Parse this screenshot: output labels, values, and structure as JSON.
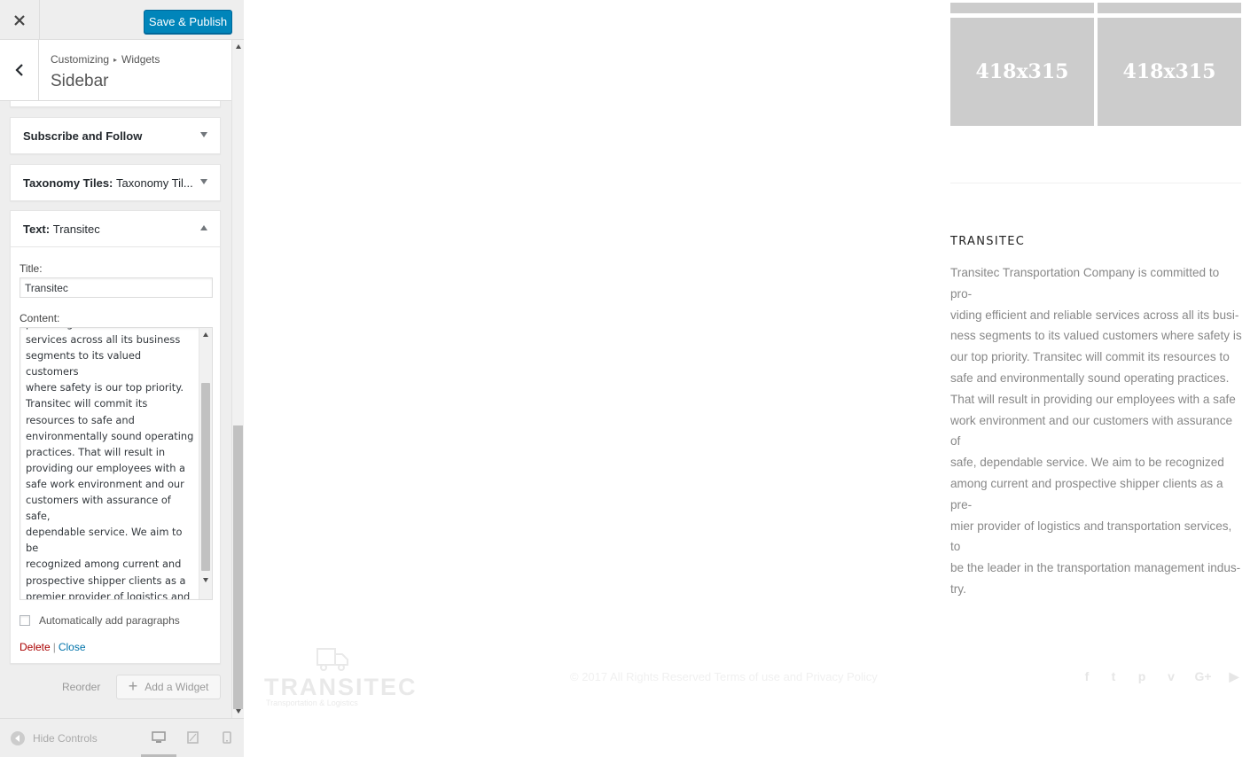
{
  "header": {
    "publish_label": "Save & Publish"
  },
  "breadcrumb": {
    "root": "Customizing",
    "current": "Widgets"
  },
  "section_title": "Sidebar",
  "widgets": [
    {
      "label": "Subscribe and Follow",
      "name": "",
      "expanded": false
    },
    {
      "label": "Taxonomy Tiles:",
      "name": "Taxonomy Til...",
      "expanded": false
    },
    {
      "label": "Text:",
      "name": "Transitec",
      "expanded": true
    }
  ],
  "text_widget": {
    "title_label": "Title:",
    "title_value": "Transitec",
    "content_label": "Content:",
    "content_lines": [
      "providing efficient and reliable",
      "services across all its business",
      "segments to its valued customers",
      "where safety is our top priority.",
      "Transitec will commit its",
      "resources to safe and",
      "environmentally sound operating",
      "practices. That will result in",
      "providing our employees with a",
      "safe work environment and our",
      "customers with assurance of safe,",
      "dependable service. We aim to be",
      "recognized among current and",
      "prospective shipper clients as a",
      "premier provider of logistics and",
      "transportation services, to be the",
      "leader in the transportation",
      "management industry."
    ],
    "autop_label": "Automatically add paragraphs",
    "delete_label": "Delete",
    "separator": "|",
    "close_label": "Close"
  },
  "actions": {
    "reorder_label": "Reorder",
    "add_widget_label": "Add a Widget"
  },
  "footer": {
    "hide_controls_label": "Hide Controls"
  },
  "preview": {
    "placeholders": [
      "418x315",
      "418x315"
    ],
    "widget_heading": "TRANSITEC",
    "widget_lines": [
      "Transitec Transportation Company is committed to pro-",
      "viding efficient and reliable services across all its busi-",
      "ness segments to its valued customers where safety is",
      "our top priority. Transitec will commit its resources to",
      "safe and environmentally sound operating practices.",
      "That will result in providing our employees with a safe",
      "work environment and our customers with assurance of",
      "safe, dependable service. We aim to be recognized",
      "among current and prospective shipper clients as a pre-",
      "mier provider of logistics and transportation services, to",
      "be the leader in the transportation management indus-",
      "try."
    ],
    "logo_text": "TRANSITEC",
    "logo_tagline": "Transportation & Logistics",
    "copyright": "© 2017 All Rights Reserved Terms of use and Privacy Policy",
    "social_icons": [
      "facebook-icon",
      "twitter-icon",
      "pinterest-icon",
      "vimeo-icon",
      "google-plus-icon",
      "youtube-icon"
    ]
  },
  "colors": {
    "primary_button": "#0085ba",
    "delete_link": "#aa0000",
    "link": "#0073aa",
    "placeholder_bg": "#cccccc"
  }
}
